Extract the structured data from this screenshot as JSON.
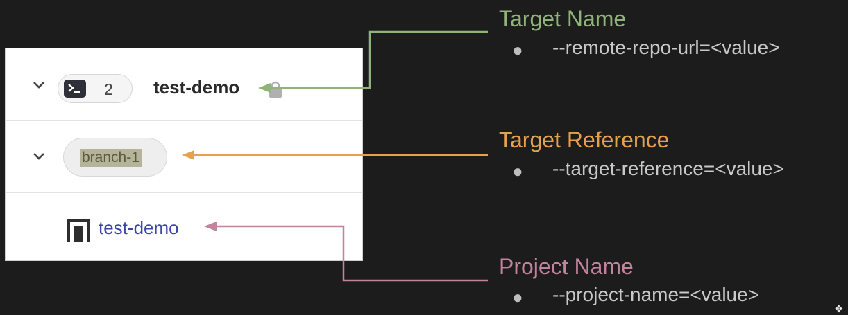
{
  "panel": {
    "target_row": {
      "count": "2",
      "name": "test-demo"
    },
    "branch_row": {
      "label": "branch-1"
    },
    "project_row": {
      "name": "test-demo"
    }
  },
  "annotations": [
    {
      "title": "Target Name",
      "flag": "--remote-repo-url=<value>",
      "color": "#8fb37a"
    },
    {
      "title": "Target Reference",
      "flag": "--target-reference=<value>",
      "color": "#e4a24e"
    },
    {
      "title": "Project Name",
      "flag": "--project-name=<value>",
      "color": "#c2839c"
    }
  ],
  "bullet_glyph": "●",
  "icons": [
    "chevron-down-icon",
    "terminal-icon",
    "lock-icon",
    "project-icon",
    "move-icon"
  ]
}
